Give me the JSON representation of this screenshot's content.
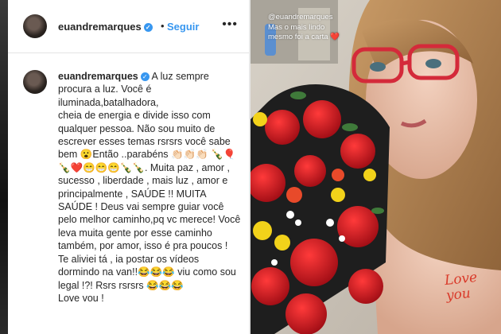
{
  "post": {
    "username": "euandremarques",
    "verified_symbol": "✓",
    "separator": "•",
    "follow_label": "Seguir",
    "more_symbol": "•••"
  },
  "comment": {
    "username": "euandremarques",
    "text": "A luz sempre procura a luz. Você é iluminada,batalhadora,\ncheia de energia e divide isso com qualquer pessoa. Não sou muito de escrever esses temas rsrsrs você sabe bem 😮Então ..parabéns 👏🏻👏🏻👏🏻 🍾🎈🍾❤️😁😁😁🍾🍾. Muita paz , amor , sucesso , liberdade , mais luz , amor e principalmente , SAÚDE !! MUITA SAÚDE ! Deus vai sempre guiar você pelo melhor caminho,pq vc merece! Você leva muita gente por esse caminho também, por amor, isso é pra poucos !\nTe aliviei tá , ia postar os vídeos dormindo na van!!😂😂😂 viu como sou legal !?! Rsrs rsrsrs 😂😂😂\nLove vou !"
  },
  "story": {
    "caption": "@euandremarques\nMas o mais lindo\nmesmo foi a carta ❤️",
    "handwriting": "Love\nyou"
  },
  "colors": {
    "link_blue": "#3897f0",
    "text": "#262626",
    "rose_red": "#c8141e",
    "glasses_red": "#d42a3a"
  }
}
